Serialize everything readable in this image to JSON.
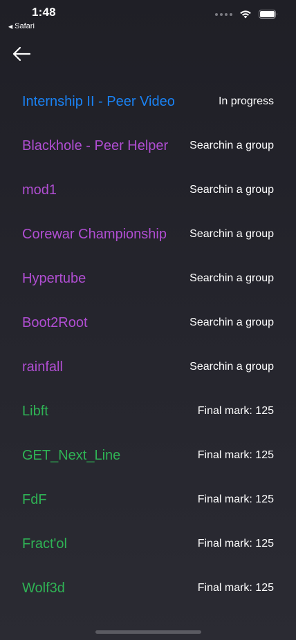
{
  "status_bar": {
    "time": "1:48",
    "back_app": "Safari",
    "icons": [
      "signal-dots-icon",
      "wifi-icon",
      "battery-icon"
    ]
  },
  "nav": {
    "back_icon": "arrow-left-icon"
  },
  "colors": {
    "in_progress": "#1a82f3",
    "searching": "#b04ed2",
    "finished": "#2fb355",
    "status_text": "#ffffff",
    "background": "#25252d"
  },
  "projects": [
    {
      "name": "Internship II - Peer Video",
      "status": "In progress",
      "state": "in_progress"
    },
    {
      "name": "Blackhole - Peer Helper",
      "status": "Searchin a group",
      "state": "searching"
    },
    {
      "name": "mod1",
      "status": "Searchin a group",
      "state": "searching"
    },
    {
      "name": "Corewar Championship",
      "status": "Searchin a group",
      "state": "searching"
    },
    {
      "name": "Hypertube",
      "status": "Searchin a group",
      "state": "searching"
    },
    {
      "name": "Boot2Root",
      "status": "Searchin a group",
      "state": "searching"
    },
    {
      "name": "rainfall",
      "status": "Searchin a group",
      "state": "searching"
    },
    {
      "name": "Libft",
      "status": "Final mark: 125",
      "state": "finished"
    },
    {
      "name": "GET_Next_Line",
      "status": "Final mark: 125",
      "state": "finished"
    },
    {
      "name": "FdF",
      "status": "Final mark: 125",
      "state": "finished"
    },
    {
      "name": "Fract'ol",
      "status": "Final mark: 125",
      "state": "finished"
    },
    {
      "name": "Wolf3d",
      "status": "Final mark: 125",
      "state": "finished"
    }
  ]
}
